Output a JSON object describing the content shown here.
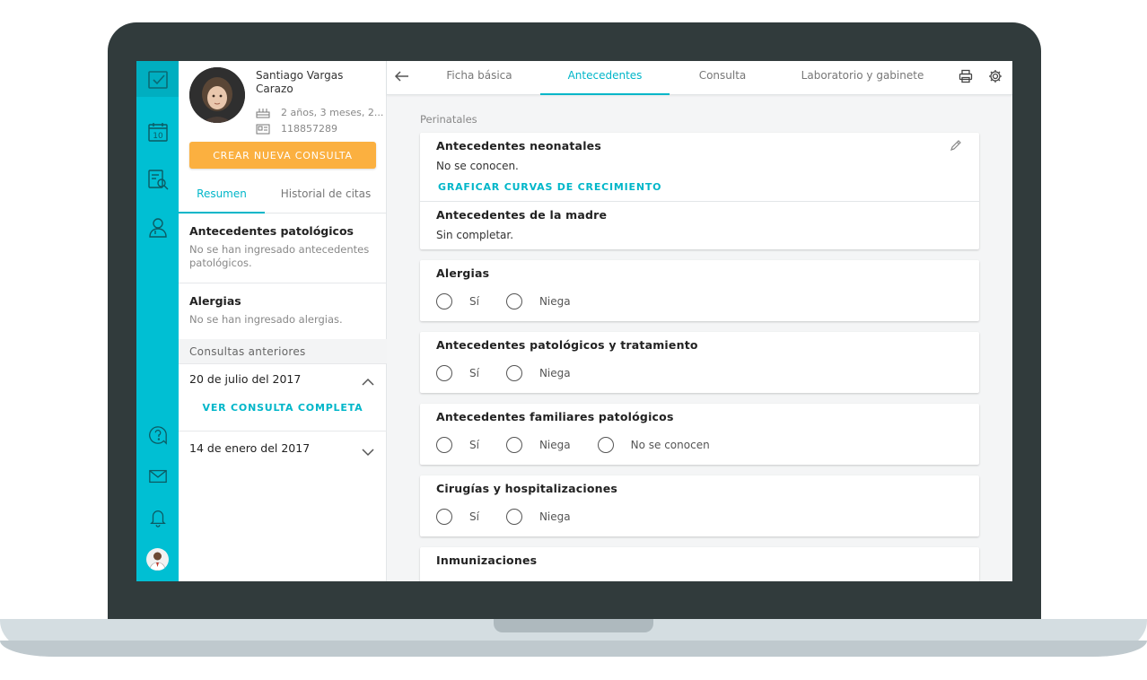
{
  "patient": {
    "name": "Santiago Vargas Carazo",
    "age": "2 años, 3 meses, 2...",
    "id": "118857289"
  },
  "sidebar": {
    "cta_label": "CREAR NUEVA CONSULTA",
    "tabs": [
      "Resumen",
      "Historial de citas"
    ],
    "patologicos_title": "Antecedentes patológicos",
    "patologicos_text": "No se han ingresado antecedentes patológicos.",
    "alergias_title": "Alergias",
    "alergias_text": "No se han ingresado alergias.",
    "consultas_label": "Consultas anteriores",
    "consultas": [
      {
        "date": "20 de julio del 2017",
        "link": "VER CONSULTA COMPLETA"
      },
      {
        "date": "14 de enero del 2017"
      }
    ]
  },
  "rail": {
    "calendar_day": "10"
  },
  "topbar": {
    "tabs": [
      "Ficha básica",
      "Antecedentes",
      "Consulta",
      "Laboratorio y gabinete"
    ]
  },
  "main": {
    "section": "Perinatales",
    "neonatales_title": "Antecedentes neonatales",
    "neonatales_text": "No se conocen.",
    "graficar_link": "GRAFICAR CURVAS DE CRECIMIENTO",
    "madre_title": "Antecedentes de la madre",
    "madre_text": "Sin completar.",
    "alergias_title": "Alergias",
    "patologicos_title": "Antecedentes patológicos y tratamiento",
    "familiares_title": "Antecedentes familiares patológicos",
    "cirugias_title": "Cirugías y hospitalizaciones",
    "inmunizaciones_title": "Inmunizaciones",
    "options": {
      "si": "Sí",
      "niega": "Niega",
      "no_conocen": "No se conocen"
    }
  }
}
